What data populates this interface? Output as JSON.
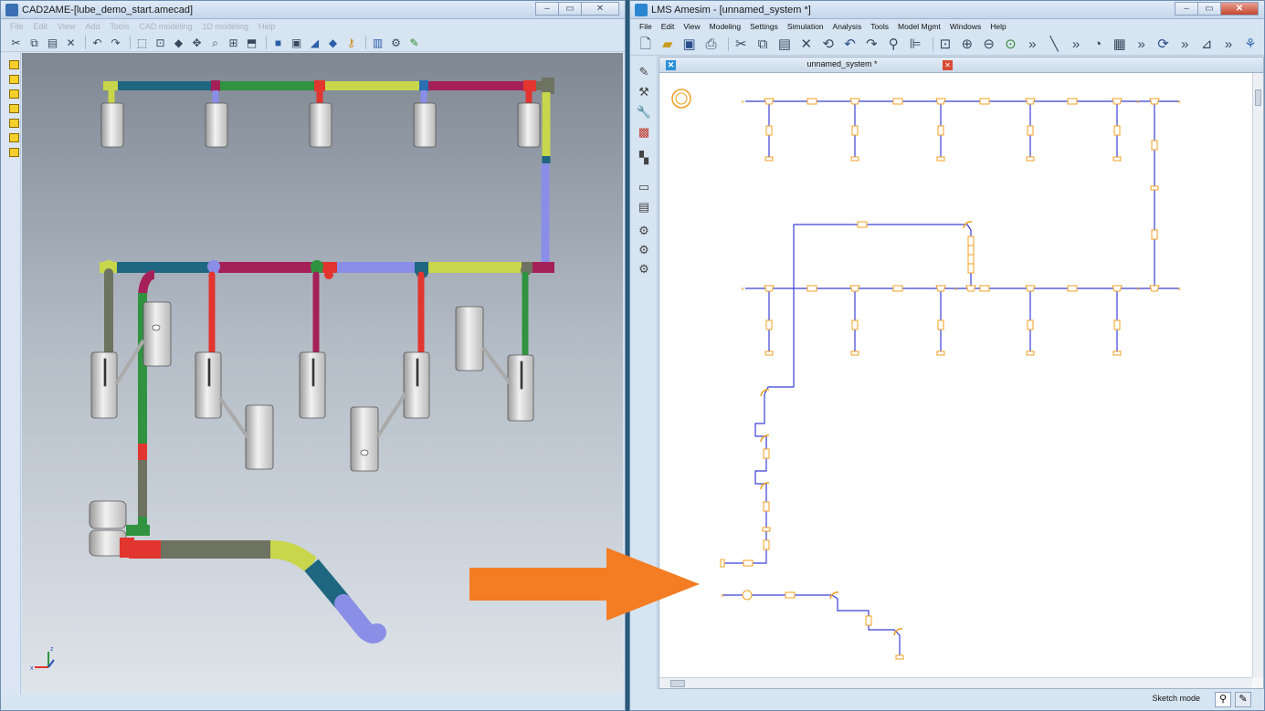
{
  "left_window": {
    "title": "CAD2AME-[lube_demo_start.amecad]",
    "menu": [
      "File",
      "Edit",
      "View",
      "Add",
      "Tools",
      "CAD modeling",
      "1D modeling",
      "Help"
    ],
    "controls": {
      "minimize": "–",
      "restore": "▭",
      "close": "✕"
    }
  },
  "right_window": {
    "title": "LMS Amesim - [unnamed_system *]",
    "menu": [
      "File",
      "Edit",
      "View",
      "Modeling",
      "Settings",
      "Simulation",
      "Analysis",
      "Tools",
      "Model Mgmt",
      "Windows",
      "Help"
    ],
    "controls": {
      "minimize": "–",
      "restore": "▭",
      "close": "✕"
    },
    "tab_title": "unnamed_system *",
    "status": {
      "mode": "Sketch mode"
    }
  },
  "colors": {
    "orange_arrow": "#f47d24",
    "pipe_yellow": "#c7d64a",
    "pipe_teal": "#1f6680",
    "pipe_green": "#2f9340",
    "pipe_red": "#e2352f",
    "pipe_magenta": "#a52058",
    "pipe_lilac": "#8a8ee6",
    "pipe_olive": "#6e7260",
    "sketch_line": "#3b3fd6",
    "sketch_component": "#f0a020"
  }
}
